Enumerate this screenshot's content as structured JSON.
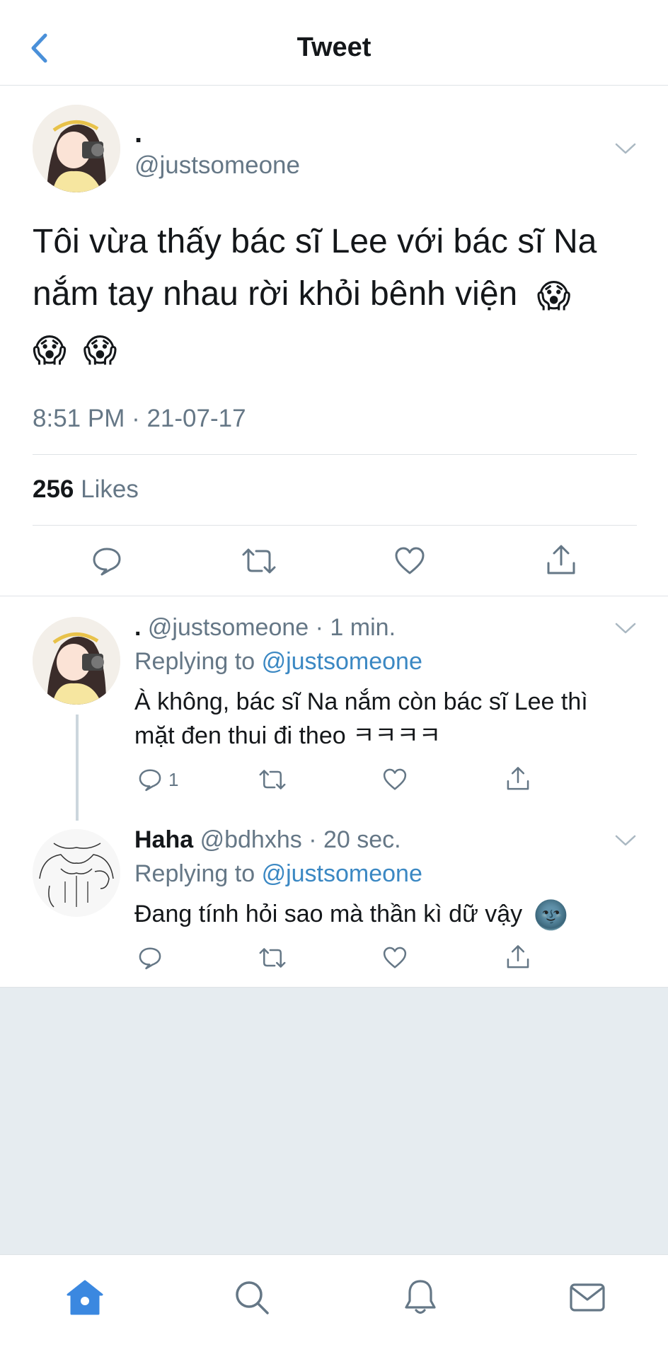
{
  "header": {
    "title": "Tweet"
  },
  "tweet": {
    "name": ".",
    "handle": "@justsomeone",
    "text": "Tôi vừa thấy bác sĩ Lee với bác sĩ Na nắm tay nhau rời khỏi bênh viện",
    "emoji": "😱",
    "timestamp": "8:51 PM · 21-07-17",
    "likes_count": "256",
    "likes_label": "Likes"
  },
  "replies": [
    {
      "name": ".",
      "handle": "@justsomeone",
      "time": "1 min.",
      "replying_prefix": "Replying to",
      "replying_to": "@justsomeone",
      "text_line1": "À không, bác sĩ Na nắm còn bác sĩ Lee thì",
      "text_line2": "mặt đen thui đi theo ㅋㅋㅋㅋ",
      "reply_count": "1"
    },
    {
      "name": "Haha",
      "handle": "@bdhxhs",
      "time": "20 sec.",
      "replying_prefix": "Replying to",
      "replying_to": "@justsomeone",
      "text": "Đang tính hỏi sao mà thần kì dữ vậy",
      "emoji": "🌚"
    }
  ],
  "colors": {
    "accent": "#3b88c3",
    "muted": "#657786",
    "divider": "#dfe3e6",
    "background_gray": "#e6ecf0"
  },
  "icons": [
    "back-chevron-icon",
    "caret-down-icon",
    "reply-icon",
    "retweet-icon",
    "like-icon",
    "share-icon",
    "home-icon",
    "search-icon",
    "notifications-icon",
    "messages-icon"
  ]
}
